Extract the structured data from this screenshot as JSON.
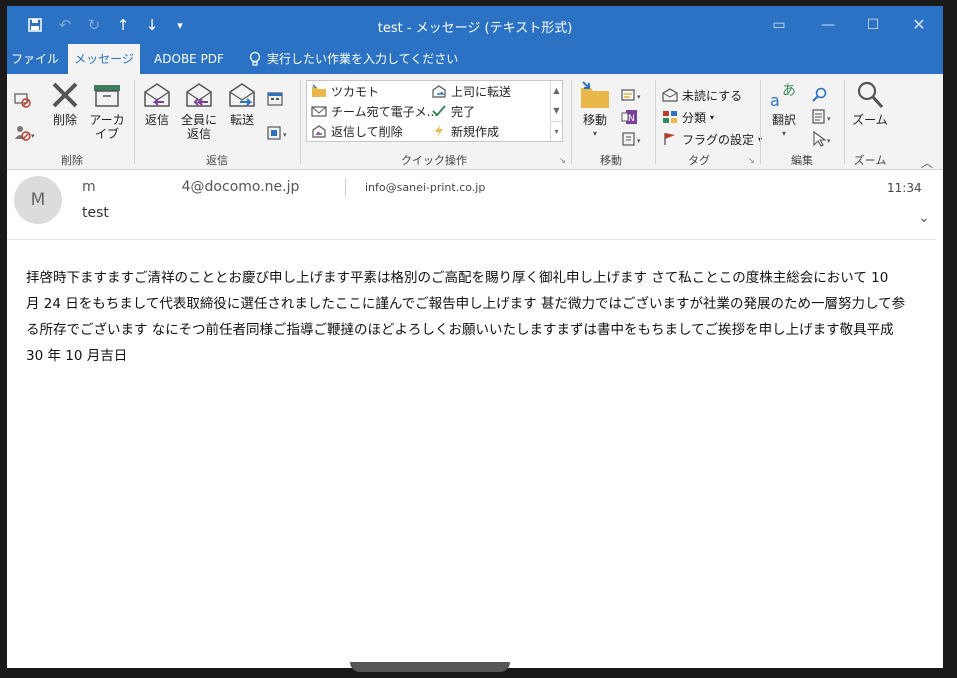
{
  "window": {
    "title": "test  -  メッセージ (テキスト形式)"
  },
  "tabs": [
    {
      "label": "ファイル"
    },
    {
      "label": "メッセージ"
    },
    {
      "label": "ADOBE PDF"
    }
  ],
  "tellme": {
    "label": "実行したい作業を入力してください"
  },
  "ribbon": {
    "delete_group": {
      "label": "削除",
      "delete_label": "削除",
      "archive_label": "アーカイブ"
    },
    "reply_group": {
      "label": "返信",
      "reply_label": "返信",
      "reply_all_label": "全員に返信",
      "forward_label": "転送"
    },
    "quick_steps": {
      "label": "クイック操作",
      "items": [
        "ツカモト",
        "チーム宛て電子メ...",
        "返信して削除",
        "上司に転送",
        "完了",
        "新規作成"
      ]
    },
    "move_group": {
      "label": "移動",
      "move_label": "移動"
    },
    "tags_group": {
      "label": "タグ",
      "unread_label": "未読にする",
      "categorize_label": "分類",
      "followup_label": "フラグの設定"
    },
    "edit_group": {
      "label": "編集",
      "translate_label": "翻訳"
    },
    "zoom_group": {
      "label": "ズーム",
      "zoom_label": "ズーム"
    }
  },
  "message": {
    "avatar_initial": "M",
    "from_prefix": "m",
    "from_suffix": "4@docomo.ne.jp",
    "to": "info@sanei-print.co.jp",
    "subject": "test",
    "time": "11:34",
    "body": "拝啓時下ますますご清祥のこととお慶び申し上げます平素は格別のご高配を賜り厚く御礼申し上げます さて私ことこの度株主総会において 10 月 24 日をもちまして代表取締役に選任されましたここに謹んでご報告申し上げます 甚だ微力ではございますが社業の発展のため一層努力して参る所存でございます なにそつ前任者同様ご指導ご鞭撻のほどよろしくお願いいたしますまずは書中をもちましてご挨拶を申し上げます敬具平成 30 年 10 月吉日"
  }
}
